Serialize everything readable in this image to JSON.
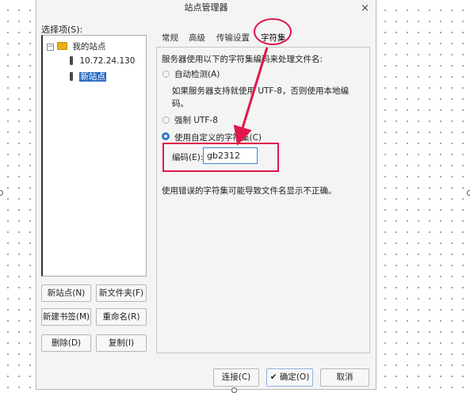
{
  "window": {
    "title": "站点管理器",
    "close_glyph": "×"
  },
  "tree": {
    "label": "选择项(S):",
    "expander": "−",
    "root": "我的站点",
    "items": [
      "10.72.24.130",
      "新站点"
    ]
  },
  "buttons": {
    "new_site": "新站点(N)",
    "new_folder": "新文件夹(F)",
    "new_bookmark": "新建书签(M)",
    "rename": "重命名(R)",
    "delete": "删除(D)",
    "copy": "复制(I)",
    "connect": "连接(C)",
    "ok": "✔ 确定(O)",
    "cancel": "取消"
  },
  "tabs": [
    "常规",
    "高级",
    "传输设置",
    "字符集"
  ],
  "charset": {
    "heading": "服务器使用以下的字符集编码来处理文件名:",
    "auto": "自动检测(A)",
    "auto_desc_line1": "如果服务器支持就使用 UTF-8，否则使用本地编",
    "auto_desc_line2": "码。",
    "force_utf8": "强制 UTF-8",
    "custom": "使用自定义的字符集(C)",
    "encoding_label": "编码(E):",
    "encoding_value": "gb2312",
    "warning": "使用错误的字符集可能导致文件名显示不正确。"
  },
  "colors": {
    "annotation": "#e0174a",
    "accent": "#2f78d0"
  }
}
